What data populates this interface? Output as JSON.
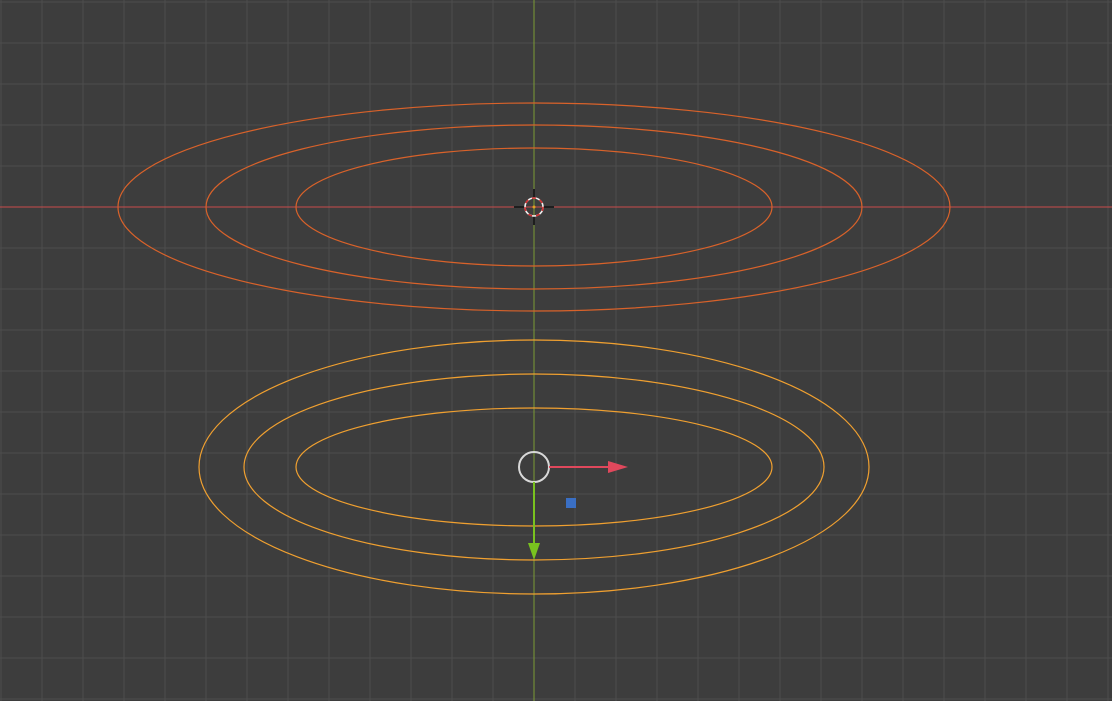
{
  "viewport": {
    "background_color": "#3d3d3d",
    "grid_color": "#4d4d4d",
    "x_axis_color": "#c94a4a",
    "y_axis_color": "#7a9a35"
  },
  "objects": {
    "unselected_color": "#d9622a",
    "selected_color": "#f0a030",
    "ring_count_per_object": 3
  },
  "gizmo": {
    "x_arrow_color": "#e0485c",
    "y_arrow_color": "#79c21f",
    "plane_handle_color": "#3a6fc4",
    "origin_ring_color": "#d8d8d8"
  },
  "cursor": {
    "name": "3d-cursor",
    "ring_red": "#d03030",
    "ring_white": "#f0f0f0"
  }
}
